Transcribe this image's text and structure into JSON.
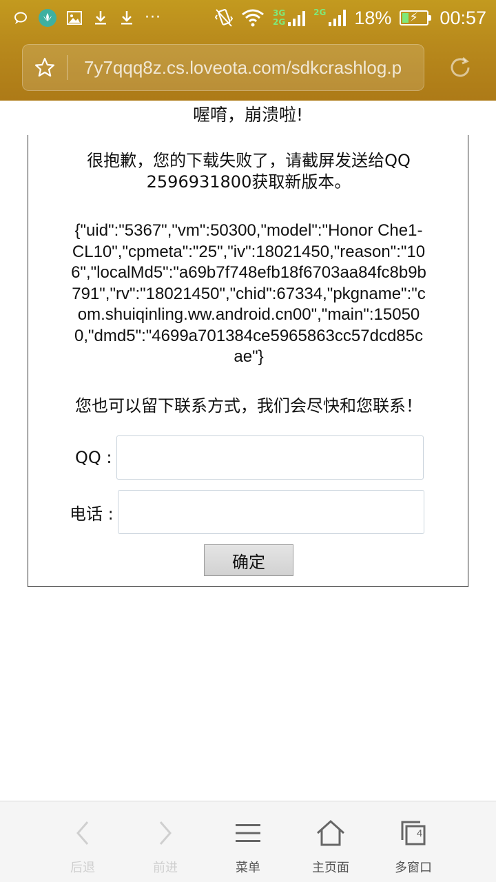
{
  "status_bar": {
    "icons_left": [
      "chat-bubble-icon",
      "huawei-app-icon",
      "image-icon",
      "download-icon",
      "download-icon",
      "more-dots-icon"
    ],
    "network_labels": [
      "3G",
      "2G"
    ],
    "network_label_right": "2G",
    "battery_percent": "18%",
    "time": "00:57"
  },
  "browser": {
    "url": "7y7qqq8z.cs.loveota.com/sdkcrashlog.p",
    "bookmark_icon": "star-icon",
    "reload_icon": "reload-icon"
  },
  "page": {
    "heading": "喔唷，崩溃啦!",
    "apology": "很抱歉，您的下载失败了，请截屏发送给QQ 2596931800获取新版本。",
    "crash_info": "{\"uid\":\"5367\",\"vm\":50300,\"model\":\"Honor Che1-CL10\",\"cpmeta\":\"25\",\"iv\":18021450,\"reason\":\"106\",\"localMd5\":\"a69b7f748efb18f6703aa84fc8b9b791\",\"rv\":\"18021450\",\"chid\":67334,\"pkgname\":\"com.shuiqinling.ww.android.cn00\",\"main\":150500,\"dmd5\":\"4699a701384ce5965863cc57dcd85cae\"}",
    "contact_note": "您也可以留下联系方式，我们会尽快和您联系！",
    "form": {
      "qq_label": "QQ :",
      "qq_value": "",
      "phone_label": "电话 :",
      "phone_value": "",
      "submit_label": "确定"
    }
  },
  "toolbar": {
    "items": [
      {
        "label": "后退",
        "icon": "back-arrow-icon",
        "enabled": false
      },
      {
        "label": "前进",
        "icon": "forward-arrow-icon",
        "enabled": false
      },
      {
        "label": "菜单",
        "icon": "menu-icon",
        "enabled": true
      },
      {
        "label": "主页面",
        "icon": "home-icon",
        "enabled": true
      },
      {
        "label": "多窗口",
        "icon": "windows-icon",
        "enabled": true,
        "badge": "4"
      }
    ]
  },
  "colors": {
    "chrome_top": "#c39a1f",
    "chrome_bottom": "#ad7a17",
    "network_green": "#7fe87a",
    "toolbar_bg": "#f5f5f5"
  }
}
